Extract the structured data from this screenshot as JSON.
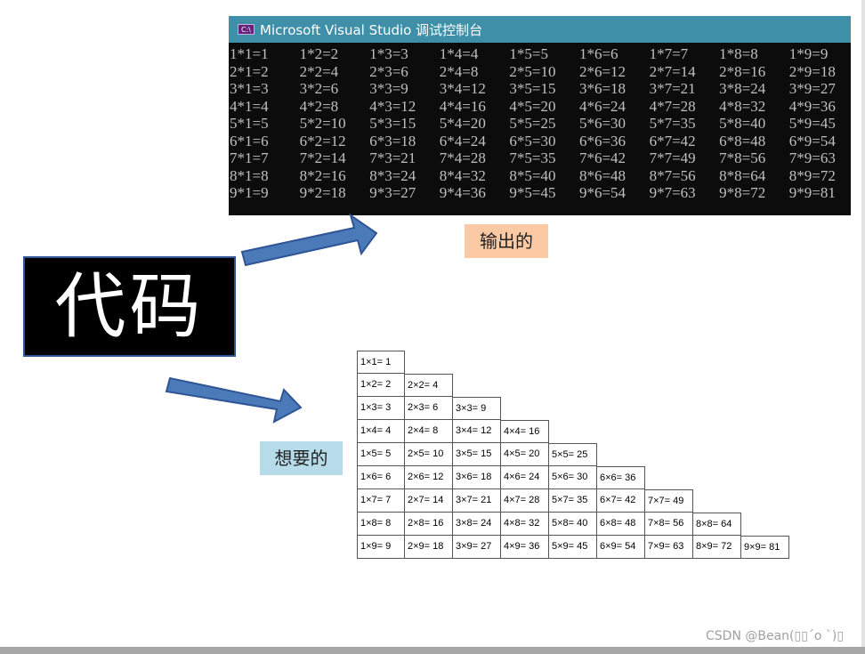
{
  "console": {
    "icon_label": "C:\\",
    "title": "Microsoft Visual Studio 调试控制台",
    "rows": [
      [
        "1*1=1",
        "1*2=2",
        "1*3=3",
        "1*4=4",
        "1*5=5",
        "1*6=6",
        "1*7=7",
        "1*8=8",
        "1*9=9"
      ],
      [
        "2*1=2",
        "2*2=4",
        "2*3=6",
        "2*4=8",
        "2*5=10",
        "2*6=12",
        "2*7=14",
        "2*8=16",
        "2*9=18"
      ],
      [
        "3*1=3",
        "3*2=6",
        "3*3=9",
        "3*4=12",
        "3*5=15",
        "3*6=18",
        "3*7=21",
        "3*8=24",
        "3*9=27"
      ],
      [
        "4*1=4",
        "4*2=8",
        "4*3=12",
        "4*4=16",
        "4*5=20",
        "4*6=24",
        "4*7=28",
        "4*8=32",
        "4*9=36"
      ],
      [
        "5*1=5",
        "5*2=10",
        "5*3=15",
        "5*4=20",
        "5*5=25",
        "5*6=30",
        "5*7=35",
        "5*8=40",
        "5*9=45"
      ],
      [
        "6*1=6",
        "6*2=12",
        "6*3=18",
        "6*4=24",
        "6*5=30",
        "6*6=36",
        "6*7=42",
        "6*8=48",
        "6*9=54"
      ],
      [
        "7*1=7",
        "7*2=14",
        "7*3=21",
        "7*4=28",
        "7*5=35",
        "7*6=42",
        "7*7=49",
        "7*8=56",
        "7*9=63"
      ],
      [
        "8*1=8",
        "8*2=16",
        "8*3=24",
        "8*4=32",
        "8*5=40",
        "8*6=48",
        "8*7=56",
        "8*8=64",
        "8*9=72"
      ],
      [
        "9*1=9",
        "9*2=18",
        "9*3=27",
        "9*4=36",
        "9*5=45",
        "9*6=54",
        "9*7=63",
        "9*8=72",
        "9*9=81"
      ]
    ]
  },
  "labels": {
    "output": "输出的",
    "code": "代码",
    "wanted": "想要的"
  },
  "triangle_table": [
    [
      "1×1= 1"
    ],
    [
      "1×2= 2",
      "2×2= 4"
    ],
    [
      "1×3= 3",
      "2×3= 6",
      "3×3= 9"
    ],
    [
      "1×4= 4",
      "2×4= 8",
      "3×4= 12",
      "4×4= 16"
    ],
    [
      "1×5= 5",
      "2×5= 10",
      "3×5= 15",
      "4×5= 20",
      "5×5= 25"
    ],
    [
      "1×6= 6",
      "2×6= 12",
      "3×6= 18",
      "4×6= 24",
      "5×6= 30",
      "6×6= 36"
    ],
    [
      "1×7= 7",
      "2×7= 14",
      "3×7= 21",
      "4×7= 28",
      "5×7= 35",
      "6×7= 42",
      "7×7= 49"
    ],
    [
      "1×8= 8",
      "2×8= 16",
      "3×8= 24",
      "4×8= 32",
      "5×8= 40",
      "6×8= 48",
      "7×8= 56",
      "8×8= 64"
    ],
    [
      "1×9= 9",
      "2×9= 18",
      "3×9= 27",
      "4×9= 36",
      "5×9= 45",
      "6×9= 54",
      "7×9= 63",
      "8×9= 72",
      "9×9= 81"
    ]
  ],
  "watermark": "CSDN @Bean(▯▯ˊo ˋ)▯",
  "colors": {
    "arrow_fill": "#4a7ab8",
    "arrow_stroke": "#2f5597",
    "titlebar": "#3f8fa8",
    "output_label_bg": "#fbc9a3",
    "wanted_label_bg": "#b6dbe9"
  }
}
